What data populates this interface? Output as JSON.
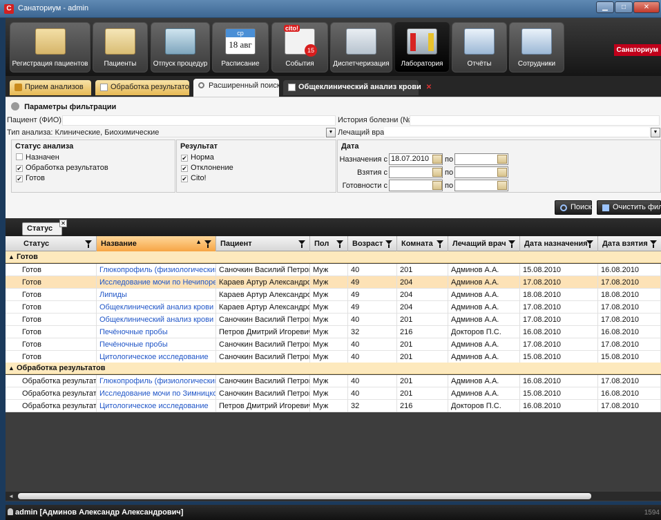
{
  "window": {
    "title": "Санаториум - admin",
    "app_badge": "С"
  },
  "toolbar": {
    "buttons": [
      {
        "label": "Регистрация пациентов",
        "icon": "registration-icon"
      },
      {
        "label": "Пациенты",
        "icon": "patients-icon"
      },
      {
        "label": "Отпуск процедур",
        "icon": "procedures-icon"
      },
      {
        "label": "Расписание",
        "icon": "calendar-icon",
        "cal_day": "ср",
        "cal_date": "18 авг"
      },
      {
        "label": "События",
        "icon": "events-icon",
        "badge_top": "cito!",
        "badge_count": "15"
      },
      {
        "label": "Диспетчеризация",
        "icon": "dispatch-icon"
      },
      {
        "label": "Лаборатория",
        "icon": "laboratory-icon",
        "active": true
      },
      {
        "label": "Отчёты",
        "icon": "reports-icon"
      },
      {
        "label": "Сотрудники",
        "icon": "staff-icon"
      }
    ],
    "brand": "Санаториум"
  },
  "doc_tabs": [
    {
      "label": "Прием анализов"
    },
    {
      "label": "Обработка результатов"
    },
    {
      "label": "Расширенный поиск",
      "active": true
    },
    {
      "label": "Общеклинический анализ крови",
      "closable": true
    }
  ],
  "filter": {
    "title": "Параметры фильтрации",
    "patient_label": "Пациент (ФИО):",
    "patient_value": "",
    "history_label": "История болезни (№):",
    "history_value": "",
    "analysis_type_label": "Тип анализа:",
    "analysis_type_value": "Клинические, Биохимические",
    "doctor_label": "Лечащий врач:",
    "doctor_value": "",
    "status_group": {
      "title": "Статус анализа",
      "items": [
        {
          "label": "Назначен",
          "checked": false
        },
        {
          "label": "Обработка результатов",
          "checked": true
        },
        {
          "label": "Готов",
          "checked": true
        }
      ]
    },
    "result_group": {
      "title": "Результат",
      "items": [
        {
          "label": "Норма",
          "checked": true
        },
        {
          "label": "Отклонение",
          "checked": true
        },
        {
          "label": "Cito!",
          "checked": true
        }
      ]
    },
    "date_group": {
      "title": "Дата",
      "to_label": "по",
      "rows": [
        {
          "label": "Назначения с",
          "from": "18.07.2010",
          "to": ""
        },
        {
          "label": "Взятия с",
          "from": "",
          "to": ""
        },
        {
          "label": "Готовности с",
          "from": "",
          "to": ""
        }
      ]
    },
    "search_button": "Поиск",
    "clear_button": "Очистить фильтр"
  },
  "grid": {
    "group_tag": "Статус",
    "columns": [
      "Статус",
      "Название",
      "Пациент",
      "Пол",
      "Возраст",
      "Комната",
      "Лечащий врач",
      "Дата назначения",
      "Дата взятия"
    ],
    "groups": [
      {
        "name": "Готов",
        "rows": [
          [
            "Готов",
            "Глюкопрофиль (физиологический тест)",
            "Саночкин Василий Петрович",
            "Муж",
            "40",
            "201",
            "Админов А.А.",
            "15.08.2010",
            "16.08.2010"
          ],
          [
            "Готов",
            "Исследование мочи по Нечипоренко",
            "Караев Артур Александрович",
            "Муж",
            "49",
            "204",
            "Админов А.А.",
            "17.08.2010",
            "17.08.2010"
          ],
          [
            "Готов",
            "Липиды",
            "Караев Артур Александрович",
            "Муж",
            "49",
            "204",
            "Админов А.А.",
            "18.08.2010",
            "18.08.2010"
          ],
          [
            "Готов",
            "Общеклинический анализ крови",
            "Караев Артур Александрович",
            "Муж",
            "49",
            "204",
            "Админов А.А.",
            "17.08.2010",
            "17.08.2010"
          ],
          [
            "Готов",
            "Общеклинический анализ крови",
            "Саночкин Василий Петрович",
            "Муж",
            "40",
            "201",
            "Админов А.А.",
            "17.08.2010",
            "17.08.2010"
          ],
          [
            "Готов",
            "Печёночные пробы",
            "Петров Дмитрий Игоревич",
            "Муж",
            "32",
            "216",
            "Докторов П.С.",
            "16.08.2010",
            "16.08.2010"
          ],
          [
            "Готов",
            "Печёночные пробы",
            "Саночкин Василий Петрович",
            "Муж",
            "40",
            "201",
            "Админов А.А.",
            "17.08.2010",
            "17.08.2010"
          ],
          [
            "Готов",
            "Цитологическое исследование",
            "Саночкин Василий Петрович",
            "Муж",
            "40",
            "201",
            "Админов А.А.",
            "15.08.2010",
            "15.08.2010"
          ]
        ]
      },
      {
        "name": "Обработка результатов",
        "rows": [
          [
            "Обработка результатов",
            "Глюкопрофиль (физиологический тест)",
            "Саночкин Василий Петрович",
            "Муж",
            "40",
            "201",
            "Админов А.А.",
            "16.08.2010",
            "17.08.2010"
          ],
          [
            "Обработка результатов",
            "Исследование мочи по Зимницкому",
            "Саночкин Василий Петрович",
            "Муж",
            "40",
            "201",
            "Админов А.А.",
            "15.08.2010",
            "16.08.2010"
          ],
          [
            "Обработка результатов",
            "Цитологическое исследование",
            "Петров Дмитрий Игоревич",
            "Муж",
            "32",
            "216",
            "Докторов П.С.",
            "16.08.2010",
            "17.08.2010"
          ]
        ]
      }
    ]
  },
  "statusbar": {
    "user": "admin [Админов Александр Александрович]",
    "version": "1594"
  },
  "colors": {
    "accent_orange": "#f6a544",
    "link_blue": "#1f55c7",
    "selected_row": "#fde2b6",
    "group_row": "#fde9bd",
    "brand_red": "#c0001a"
  }
}
